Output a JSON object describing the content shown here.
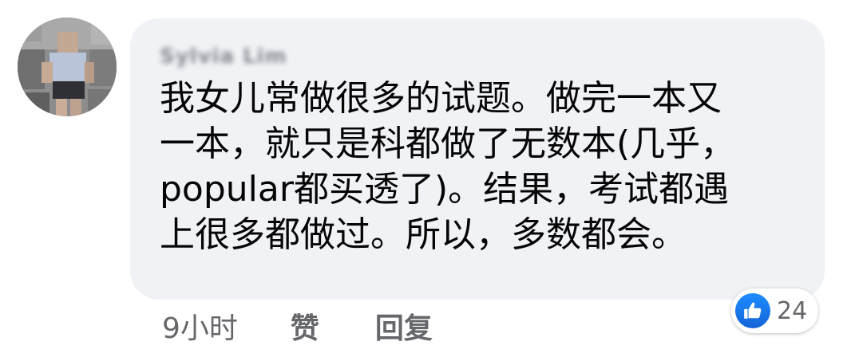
{
  "comment": {
    "author_name": "Sylvia Lim",
    "text": "我女儿常做很多的试题。做完一本又\n一本，就只是科都做了无数本(几乎，\npopular都买透了)。结果，考试都遇\n上很多都做过。所以，多数都会。",
    "timestamp": "9小时",
    "like_label": "赞",
    "reply_label": "回复",
    "reaction_count": "24",
    "reaction_icon": "thumbs-up-icon",
    "avatar_icon": "blurred-profile-photo"
  },
  "colors": {
    "bubble_bg": "#f0f2f5",
    "text": "#050505",
    "secondary_text": "#65676b",
    "like_blue": "#1877f2"
  }
}
